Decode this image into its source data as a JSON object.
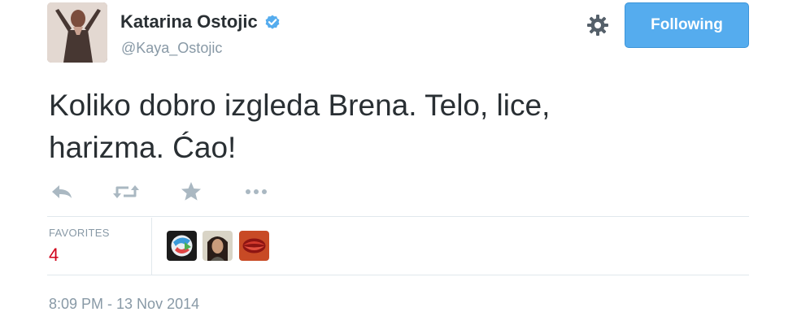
{
  "author": {
    "name": "Katarina Ostojic",
    "handle": "@Kaya_Ostojic",
    "verified": true,
    "avatar_icon": "profile-photo"
  },
  "header": {
    "follow_label": "Following",
    "settings_icon": "gear-icon"
  },
  "tweet": {
    "text_line1": "Koliko dobro izgleda Brena. Telo, lice,",
    "text_line2": "harizma. Ćao!"
  },
  "actions": [
    {
      "name": "reply-icon"
    },
    {
      "name": "retweet-icon"
    },
    {
      "name": "favorite-star-icon"
    },
    {
      "name": "more-icon"
    }
  ],
  "stats": {
    "favorites_label": "FAVORITES",
    "favorites_count": "4"
  },
  "favoriters": [
    {
      "name": "favoriter-avatar-1"
    },
    {
      "name": "favoriter-avatar-2"
    },
    {
      "name": "favoriter-avatar-3"
    }
  ],
  "meta": {
    "timestamp": "8:09 PM - 13 Nov 2014"
  },
  "colors": {
    "accent": "#55acee",
    "text": "#292f33",
    "muted": "#8899a6",
    "favorite": "#d0021b"
  }
}
